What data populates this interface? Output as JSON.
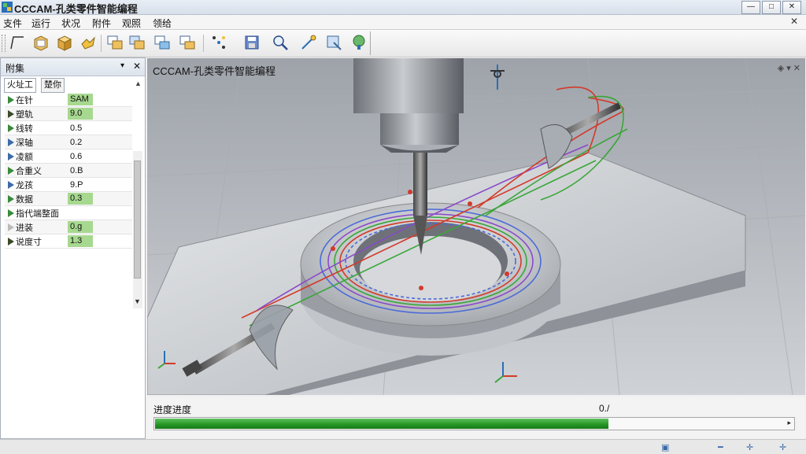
{
  "window": {
    "title": "CCCAM-孔类零件智能编程",
    "minimize": "—",
    "maximize": "□",
    "close": "✕"
  },
  "menu": {
    "items": [
      "支件",
      "运行",
      "状况",
      "附件",
      "观照",
      "领给"
    ],
    "close": "✕"
  },
  "toolbar": {
    "icons": [
      "line-tool-icon",
      "open-box-icon",
      "solid-box-icon",
      "hand-tool-icon",
      "layer-icon-1",
      "layer-icon-2",
      "layer-icon-3",
      "layer-icon-4",
      "points-icon",
      "save-icon",
      "zoom-icon",
      "probe-icon",
      "frame-icon",
      "tree-icon"
    ]
  },
  "panel": {
    "title": "附集",
    "pin": "▾",
    "close": "✕",
    "tabs": [
      "火址工",
      "楚你"
    ],
    "tab_scroll": "▲",
    "scroll_down": "▼",
    "rows": [
      {
        "label": "在针",
        "value": "SAM",
        "icon": "green",
        "highlight": true
      },
      {
        "label": "塑轨",
        "value": "9.0",
        "icon": "dark",
        "highlight": true
      },
      {
        "label": "线转",
        "value": "0.5",
        "icon": "green",
        "highlight": false
      },
      {
        "label": "深轴",
        "value": "0.2",
        "icon": "blue",
        "highlight": false
      },
      {
        "label": "凌额",
        "value": "0.6",
        "icon": "blue",
        "highlight": false
      },
      {
        "label": "合重义",
        "value": "0.B",
        "icon": "green",
        "highlight": false
      },
      {
        "label": "龙孩",
        "value": "9.P",
        "icon": "blue",
        "highlight": false
      },
      {
        "label": "数据",
        "value": "0.3",
        "icon": "green",
        "highlight": true
      },
      {
        "label": "指代端整面",
        "value": "",
        "icon": "green",
        "highlight": false
      },
      {
        "label": "进装",
        "value": "0.g",
        "icon": "gray",
        "highlight": true
      },
      {
        "label": "说度寸",
        "value": "1.3",
        "icon": "dark",
        "highlight": true
      }
    ]
  },
  "viewport": {
    "title": "CCCAM-孔类零件智能编程",
    "controls": "◈ ▾ ✕"
  },
  "progress": {
    "label": "进度进度",
    "value_text": "0./",
    "fraction": 0.71,
    "end_arrow": "▸"
  },
  "colors": {
    "accent_green": "#239423",
    "path_green": "#3aa63a",
    "path_red": "#d23a2a",
    "path_blue": "#4a6ad8",
    "path_purple": "#8a4ac8"
  },
  "status": {
    "icons": [
      "▣",
      "━",
      "✛",
      "✛"
    ]
  }
}
